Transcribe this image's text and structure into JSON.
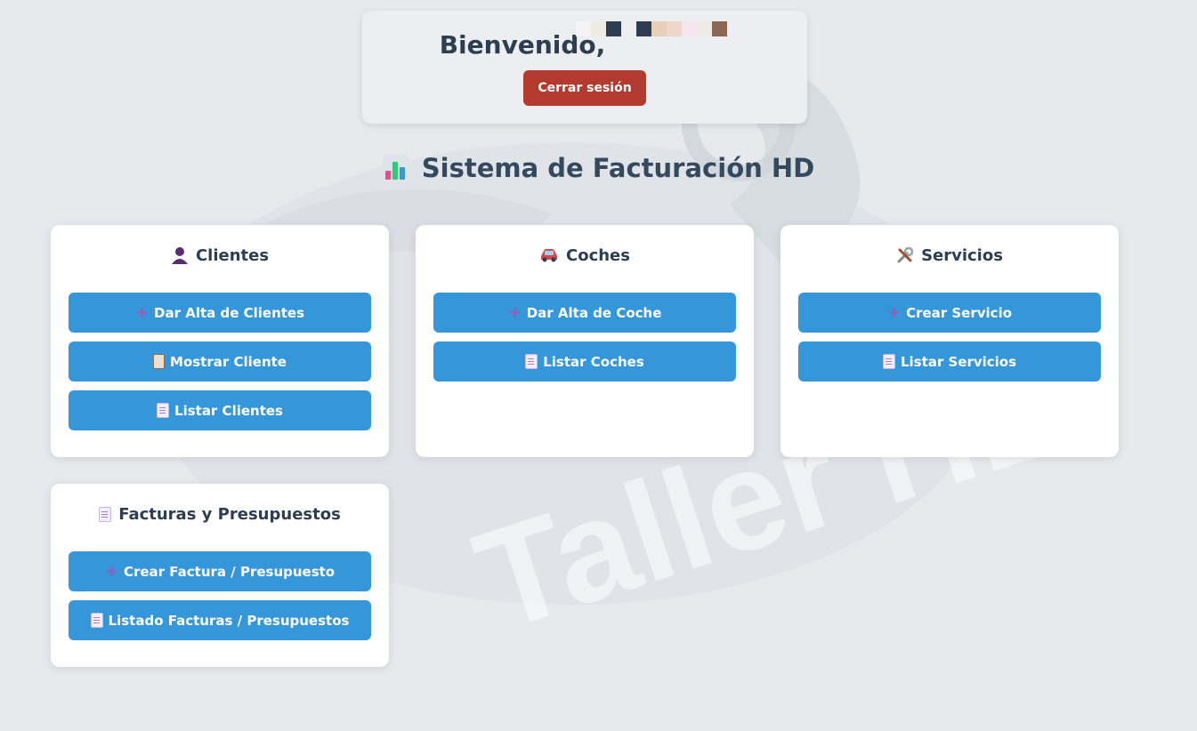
{
  "header": {
    "welcome_text": "Bienvenido,",
    "logout_label": "Cerrar sesión"
  },
  "page_title": "Sistema de Facturación HD",
  "background_watermark": "Taller HD",
  "colors": {
    "primary_button": "#3597d9",
    "logout_button": "#b23a2f",
    "heading": "#2c3e50",
    "background": "#e7e9ed"
  },
  "cards": {
    "clientes": {
      "title": "Clientes",
      "icon": "person-icon",
      "buttons": [
        {
          "label": "Dar Alta de Clientes",
          "icon": "plus-icon"
        },
        {
          "label": "Mostrar Cliente",
          "icon": "clipboard-icon"
        },
        {
          "label": "Listar Clientes",
          "icon": "document-icon"
        }
      ]
    },
    "coches": {
      "title": "Coches",
      "icon": "car-icon",
      "buttons": [
        {
          "label": "Dar Alta de Coche",
          "icon": "plus-icon"
        },
        {
          "label": "Listar Coches",
          "icon": "document-icon"
        }
      ]
    },
    "servicios": {
      "title": "Servicios",
      "icon": "tools-icon",
      "buttons": [
        {
          "label": "Crear Servicio",
          "icon": "plus-icon"
        },
        {
          "label": "Listar Servicios",
          "icon": "document-icon"
        }
      ]
    },
    "facturas": {
      "title": "Facturas y Presupuestos",
      "icon": "document-icon",
      "buttons": [
        {
          "label": "Crear Factura / Presupuesto",
          "icon": "plus-icon"
        },
        {
          "label": "Listado Facturas / Presupuestos",
          "icon": "document-icon"
        }
      ]
    }
  }
}
